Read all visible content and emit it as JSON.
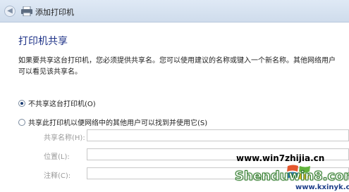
{
  "window": {
    "title": "添加打印机"
  },
  "main": {
    "heading": "打印机共享",
    "description": "如果要共享这台打印机，您必须提供共享名。您可以使用建议的名称或键入一个新名称。其他网络用户可以看见该共享名。",
    "options": [
      {
        "label": "不共享这台打印机(O)",
        "checked": true
      },
      {
        "label": "共享此打印机以便网络中的其他用户可以找到并使用它(S)",
        "checked": false
      }
    ],
    "fields": [
      {
        "label": "共享名称(H):",
        "value": ""
      },
      {
        "label": "位置(L):",
        "value": ""
      },
      {
        "label": "注释(C):",
        "value": ""
      }
    ]
  },
  "watermark": {
    "site_a": "www.win7zhijia.cn",
    "site_b": "Shenduwin8.com",
    "site_c": "www.kxinyk.com"
  },
  "icons": {
    "back": "back-arrow-icon",
    "printer": "printer-icon"
  }
}
